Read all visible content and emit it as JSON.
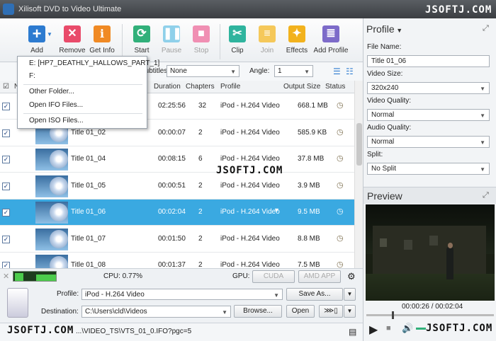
{
  "window": {
    "title": "Xilisoft DVD to Video Ultimate"
  },
  "watermark": "JSOFTJ.COM",
  "toolbar": {
    "add": "Add",
    "remove": "Remove",
    "get_info": "Get Info",
    "start": "Start",
    "pause": "Pause",
    "stop": "Stop",
    "clip": "Clip",
    "join": "Join",
    "effects": "Effects",
    "add_profile": "Add Profile"
  },
  "menu": {
    "items": [
      "E: [HP7_DEATHLY_HALLOWS_PART_1]",
      "F:",
      "Other Folder...",
      "Open IFO Files...",
      "Open ISO Files..."
    ]
  },
  "filter": {
    "subtitles_label": "Subtitles:",
    "subtitles_value": "None",
    "angle_label": "Angle:",
    "angle_value": "1"
  },
  "table": {
    "headers": {
      "n": "N",
      "duration": "Duration",
      "chapters": "Chapters",
      "profile": "Profile",
      "output_size": "Output Size",
      "status": "Status"
    },
    "rows": [
      {
        "name": "",
        "duration": "02:25:56",
        "chapters": "32",
        "profile": "iPod - H.264 Video",
        "size": "668.1 MB"
      },
      {
        "name": "Title 01_02",
        "duration": "00:00:07",
        "chapters": "2",
        "profile": "iPod - H.264 Video",
        "size": "585.9 KB"
      },
      {
        "name": "Title 01_04",
        "duration": "00:08:15",
        "chapters": "6",
        "profile": "iPod - H.264 Video",
        "size": "37.8 MB"
      },
      {
        "name": "Title 01_05",
        "duration": "00:00:51",
        "chapters": "2",
        "profile": "iPod - H.264 Video",
        "size": "3.9 MB"
      },
      {
        "name": "Title 01_06",
        "duration": "00:02:04",
        "chapters": "2",
        "profile": "iPod - H.264 Video",
        "size": "9.5 MB"
      },
      {
        "name": "Title 01_07",
        "duration": "00:01:50",
        "chapters": "2",
        "profile": "iPod - H.264 Video",
        "size": "8.8 MB"
      },
      {
        "name": "Title 01_08",
        "duration": "00:01:37",
        "chapters": "2",
        "profile": "iPod - H.264 Video",
        "size": "7.5 MB"
      }
    ]
  },
  "cpu": {
    "cpu": "CPU: 0.77%",
    "gpu": "GPU:",
    "cuda": "CUDA",
    "amd": "AMD APP"
  },
  "bottom": {
    "profile_label": "Profile:",
    "profile_value": "iPod - H.264 Video",
    "save_as": "Save As...",
    "destination_label": "Destination:",
    "destination_value": "C:\\Users\\cld\\Videos",
    "browse": "Browse...",
    "open": "Open"
  },
  "status": {
    "path": "...\\VIDEO_TS\\VTS_01_0.IFO?pgc=5"
  },
  "right": {
    "profile_title": "Profile",
    "file_name_label": "File Name:",
    "file_name": "Title 01_06",
    "video_size_label": "Video Size:",
    "video_size": "320x240",
    "video_quality_label": "Video Quality:",
    "video_quality": "Normal",
    "audio_quality_label": "Audio Quality:",
    "audio_quality": "Normal",
    "split_label": "Split:",
    "split": "No Split",
    "preview_title": "Preview",
    "time": "00:00:26 / 00:02:04"
  }
}
